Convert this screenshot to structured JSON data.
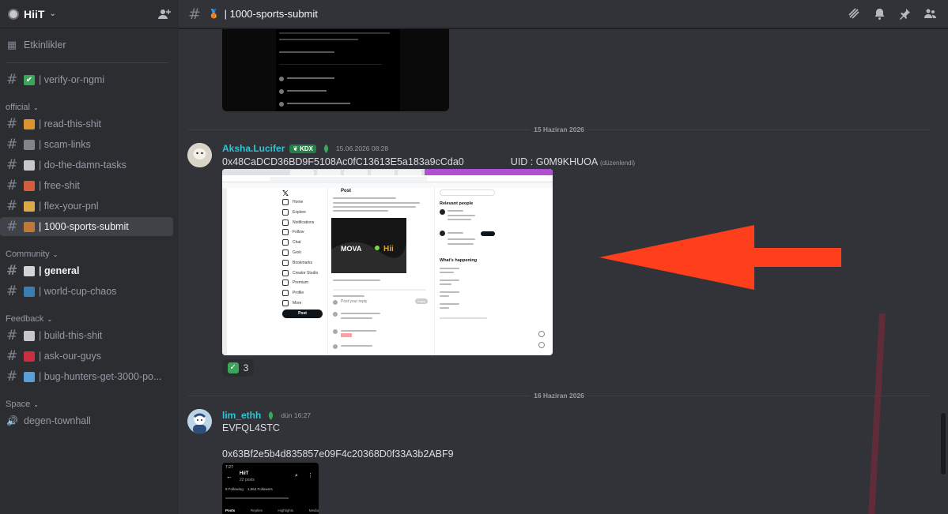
{
  "server": {
    "name": "HiiT"
  },
  "topbar": {
    "channel_name": "| 1000-sports-submit"
  },
  "sidebar": {
    "events_label": "Etkinlikler",
    "verify_channel": "| verify-or-ngmi",
    "categories": {
      "official": "official",
      "community": "Community",
      "feedback": "Feedback",
      "space": "Space"
    },
    "official_channels": [
      {
        "label": "| read-this-shit",
        "emoji": "📣",
        "color": "#f0a030"
      },
      {
        "label": "| scam-links",
        "emoji": "🔗",
        "color": "#8a8f98"
      },
      {
        "label": "| do-the-damn-tasks",
        "emoji": "📃",
        "color": "#d8d8d8"
      },
      {
        "label": "| free-shit",
        "emoji": "🎁",
        "color": "#e8643c"
      },
      {
        "label": "| flex-your-pnl",
        "emoji": "💰",
        "color": "#f2b84b"
      },
      {
        "label": "| 1000-sports-submit",
        "emoji": "🥉",
        "color": "#cd7f32"
      }
    ],
    "community_channels": [
      {
        "label": "| general",
        "emoji": "💬",
        "color": "#e3e5e8"
      },
      {
        "label": "| world-cup-chaos",
        "emoji": "🌎",
        "color": "#3b88c3"
      }
    ],
    "feedback_channels": [
      {
        "label": "| build-this-shit",
        "emoji": "📋",
        "color": "#d8d8d8"
      },
      {
        "label": "| ask-our-guys",
        "emoji": "❓",
        "color": "#dd2e44"
      },
      {
        "label": "| bug-hunters-get-3000-po...",
        "emoji": "💎",
        "color": "#5dadec"
      }
    ],
    "space_channels": [
      {
        "label": "degen-townhall",
        "emoji": "🔊"
      }
    ]
  },
  "messages": {
    "divider_1": "15 Haziran 2026",
    "divider_2": "16 Haziran 2026",
    "msg1": {
      "username": "Aksha.Lucifer",
      "tag": "KDX",
      "timestamp": "15.06.2026 08:28",
      "text": "0x48CaDCD36BD9F5108Ac0fC13613E5a183a9cCda0                 UID : G0M9KHUOA",
      "edited": "(düzenlendi)",
      "reaction": {
        "emoji": "✅",
        "count": "3"
      }
    },
    "msg2": {
      "username": "lim_ethh",
      "timestamp": "dün 16:27",
      "line1": "EVFQL4STC",
      "line2": "0x63Bf2e5b4d835857e09F4c20368D0f33A3b2ABF9"
    }
  },
  "mock_x_screenshot": {
    "nav": [
      "Home",
      "Explore",
      "Notifications",
      "Follow",
      "Chat",
      "Grok",
      "Bookmarks",
      "Creator Studio",
      "Premium",
      "Profile",
      "More"
    ],
    "post_button": "Post",
    "post_header": "Post",
    "relevant_people": "Relevant people",
    "whats_happening": "What's happening",
    "reply_placeholder": "Post your reply",
    "reply_button": "Reply",
    "media_brand": "MOVA",
    "media_brand2": "Hii"
  },
  "mock_profile": {
    "time": "7:27",
    "name": "HiiT",
    "posts": "22 posts",
    "following": "8 Following",
    "followers": "1,564 Followers",
    "tabs": [
      "Posts",
      "Replies",
      "Highlights",
      "Media"
    ]
  },
  "colors": {
    "username_1": "#2dc7d4",
    "username_2": "#2dc7d4",
    "arrow": "#ff3f1c"
  }
}
